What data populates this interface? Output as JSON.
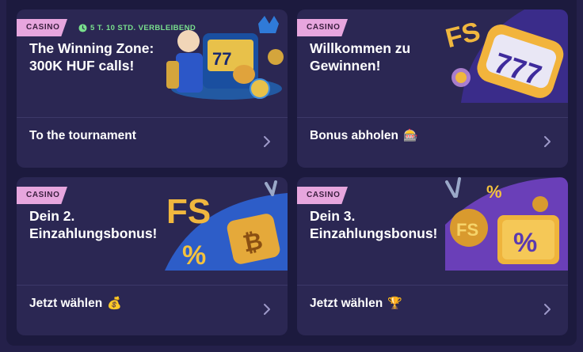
{
  "cards": [
    {
      "tag": "CASINO",
      "timer": "5 T. 10 STD. VERBLEIBEND",
      "title": "The Winning Zone: 300K HUF calls!",
      "cta": "To the tournament",
      "cta_icon": ""
    },
    {
      "tag": "CASINO",
      "title": "Willkommen zu Gewinnen!",
      "cta": "Bonus abholen",
      "cta_icon": "🎰"
    },
    {
      "tag": "CASINO",
      "title": "Dein 2. Einzahlungsbonus!",
      "cta": "Jetzt wählen",
      "cta_icon": "💰"
    },
    {
      "tag": "CASINO",
      "title": "Dein 3. Einzahlungsbonus!",
      "cta": "Jetzt wählen",
      "cta_icon": "🏆"
    }
  ],
  "icons": {
    "clock": "clock-icon",
    "chevron": "chevron-right-icon",
    "art1": "slot-machine-king-illustration",
    "art2": "fs-777-slot-illustration",
    "art3": "fs-percent-bitcoin-illustration",
    "art4": "fs-percent-safe-illustration"
  },
  "colors": {
    "tag": "#e7a6de",
    "timer": "#79e08d",
    "card": "#2b2753",
    "background": "#1c1a3e"
  }
}
